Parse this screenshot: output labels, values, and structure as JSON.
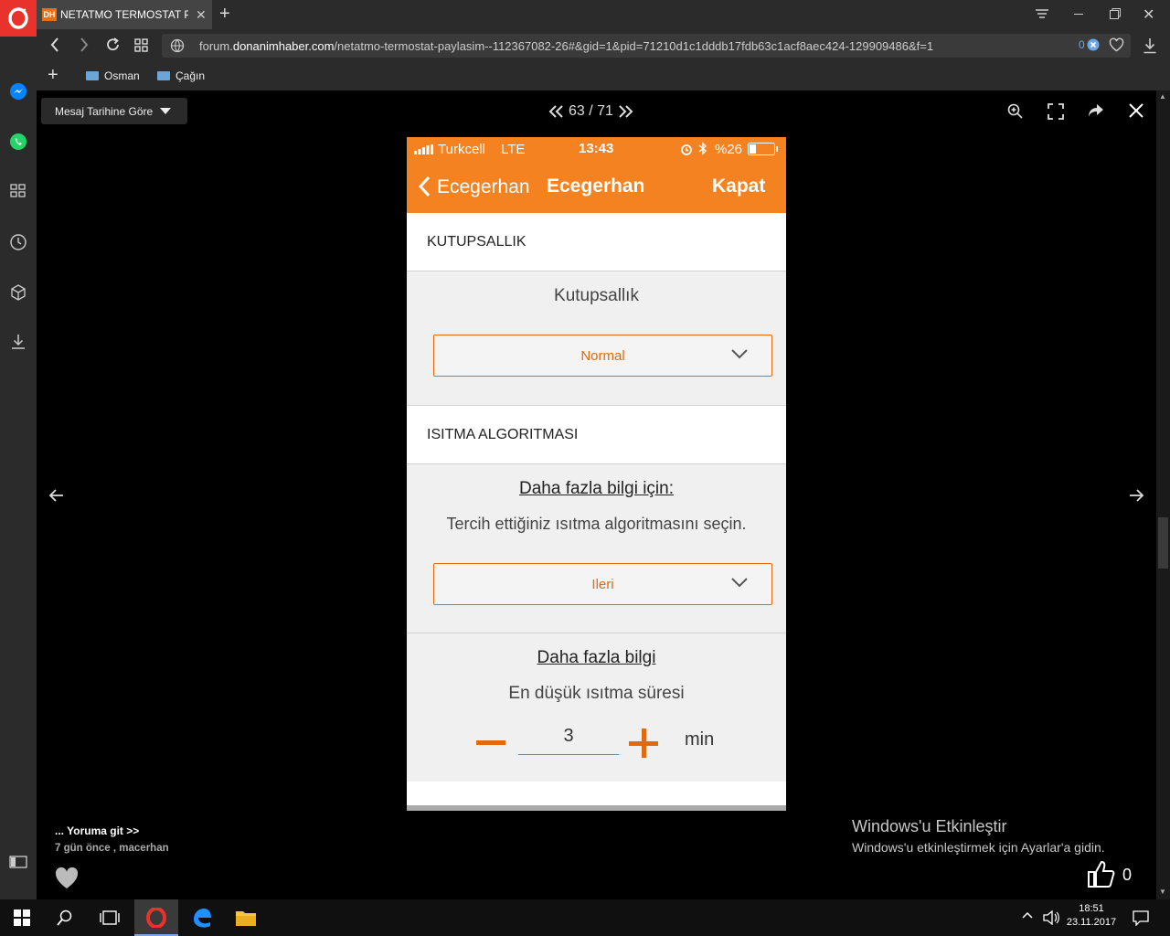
{
  "browser": {
    "tab_title": "NETATMO TERMOSTAT PAYLAŞIM",
    "tab_favicon": "DH",
    "url_prefix": "forum.",
    "url_domain": "donanimhaber.com",
    "url_rest": "/netatmo-termostat-paylasim--112367082-26#&gid=1&pid=71210d1c1dddb17fdb63c1acf8aec424-129909486&f=1",
    "adblock_count": "0",
    "bookmarks": [
      "Osman",
      "Çağın"
    ]
  },
  "viewer": {
    "sort_label": "Mesaj Tarihine Göre",
    "page_counter": "63 / 71",
    "comment_link": "... Yoruma git >>",
    "comment_meta": "7 gün önce , macerhan",
    "like_count": "0"
  },
  "phone": {
    "carrier": "Turkcell",
    "network": "LTE",
    "time": "13:43",
    "battery": "%26",
    "nav_back": "Ecegerhan",
    "nav_title": "Ecegerhan",
    "nav_close": "Kapat",
    "section1_title": "KUTUPSALLIK",
    "polarity_label": "Kutupsallık",
    "polarity_value": "Normal",
    "section2_title": "ISITMA ALGORITMASI",
    "more_info_link": "Daha fazla bilgi için:",
    "algo_prompt": "Tercih ettiğiniz ısıtma algoritmasını seçin.",
    "algo_value": "Ileri",
    "more_info_link2": "Daha fazla bilgi",
    "min_heat_label": "En düşük ısıtma süresi",
    "min_heat_value": "3",
    "min_heat_unit": "min",
    "accent": "#f58220"
  },
  "watermark": {
    "title": "Windows'u Etkinleştir",
    "subtitle": "Windows'u etkinleştirmek için Ayarlar'a gidin."
  },
  "taskbar": {
    "time": "18:51",
    "date": "23.11.2017"
  }
}
